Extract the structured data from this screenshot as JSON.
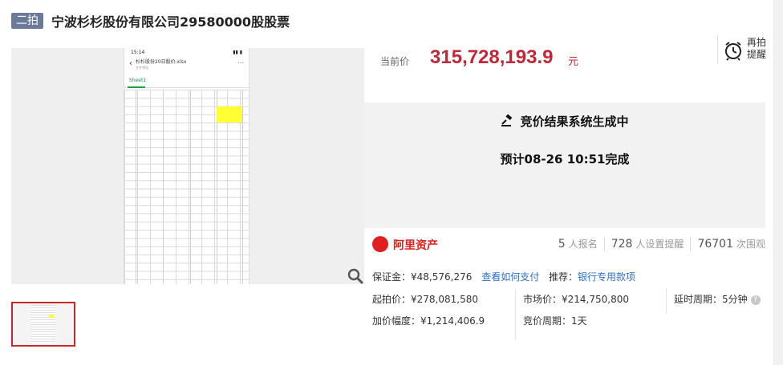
{
  "header": {
    "round_badge": "二拍",
    "title": "宁波杉杉股份有限公司29580000股股票"
  },
  "gallery": {
    "phone_time": "15:14",
    "phone_filename": "杉杉股份20日股价.xlsx",
    "phone_subtitle": "文件预览",
    "sheet_tab": "Sheet1"
  },
  "price": {
    "label": "当前价",
    "value": "315,728,193.9",
    "unit": "元"
  },
  "remind": {
    "label": "再拍提醒",
    "icon": "alarm-clock-icon"
  },
  "status": {
    "line1": "竞价结果系统生成中",
    "line2": "预计08-26 10:51完成",
    "icon": "gavel-icon"
  },
  "platform": {
    "name": "阿里资产",
    "stats": [
      {
        "number": "5",
        "label": "人报名"
      },
      {
        "number": "728",
        "label": "人设置提醒"
      },
      {
        "number": "76701",
        "label": "次围观"
      }
    ]
  },
  "info": {
    "deposit_label": "保证金：",
    "deposit_value": "¥48,576,276",
    "deposit_link": "查看如何支付",
    "recommend_label": "推荐：",
    "recommend_link": "银行专用款项",
    "start_price_label": "起拍价：",
    "start_price_value": "¥278,081,580",
    "market_price_label": "市场价：",
    "market_price_value": "¥214,750,800",
    "delay_label": "延时周期：",
    "delay_value": "5分钟",
    "increment_label": "加价幅度：",
    "increment_value": "¥1,214,406.9",
    "cycle_label": "竞价周期：",
    "cycle_value": "1天"
  },
  "colors": {
    "price_red": "#c0283a",
    "link_blue": "#2d6fc8",
    "badge_gray": "#6b7a99",
    "ali_red": "#e02020"
  }
}
